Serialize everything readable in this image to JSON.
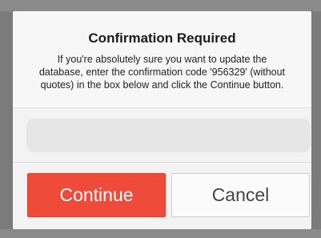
{
  "dialog": {
    "title": "Confirmation Required",
    "message_line1": "If you're absolutely sure you want to update the",
    "message_line2": "database, enter the confirmation code '956329' (without",
    "message_line3": "quotes) in the box below and click the Continue button.",
    "input": {
      "value": "",
      "placeholder": ""
    },
    "buttons": {
      "continue_label": "Continue",
      "cancel_label": "Cancel"
    }
  },
  "colors": {
    "continue_bg": "#ee4b3b",
    "cancel_bg": "#fbfbfb",
    "backdrop": "#7b7b7b"
  }
}
